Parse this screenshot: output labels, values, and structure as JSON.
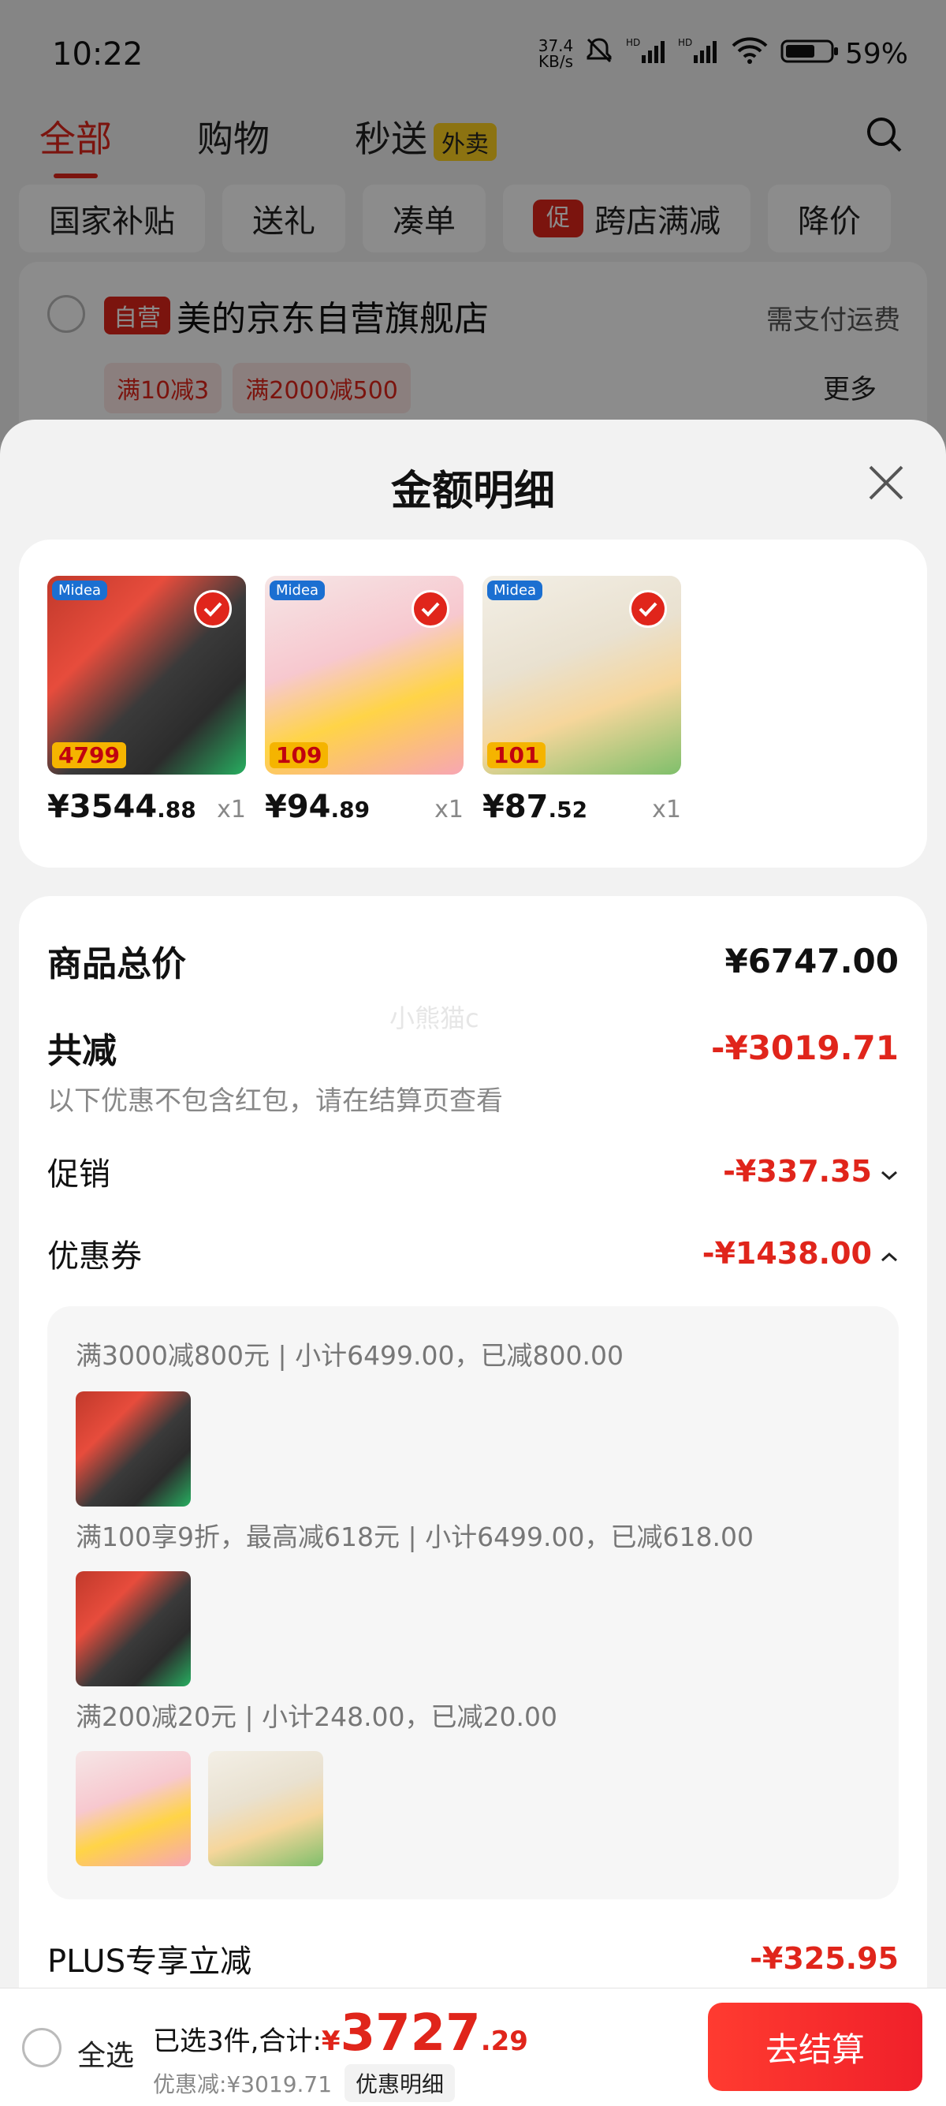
{
  "status_bar": {
    "time": "10:22",
    "net_speed_value": "37.4",
    "net_speed_unit": "KB/s",
    "battery": "59%",
    "icons": [
      "bell-muted-icon",
      "hd-signal-icon",
      "hd-signal-icon",
      "wifi-icon",
      "battery-icon"
    ]
  },
  "top_tabs": {
    "items": [
      "全部",
      "购物",
      "秒送"
    ],
    "waimai_badge": "外卖",
    "active_index": 0
  },
  "filters": {
    "items": [
      "国家补贴",
      "送礼",
      "凑单",
      "跨店满减",
      "降价"
    ],
    "promo_badge": "促"
  },
  "shop": {
    "badge": "自营",
    "name": "美的京东自营旗舰店",
    "shipping_note": "需支付运费",
    "coupons": [
      "满10减3",
      "满2000减500"
    ],
    "more": "更多"
  },
  "sheet": {
    "title": "金额明细",
    "products": [
      {
        "price_int": "¥3544",
        "price_dec": ".88",
        "qty": "x1",
        "thumb_badge": "Midea",
        "thumb_price": "4799"
      },
      {
        "price_int": "¥94",
        "price_dec": ".89",
        "qty": "x1",
        "thumb_badge": "Midea",
        "thumb_price": "109"
      },
      {
        "price_int": "¥87",
        "price_dec": ".52",
        "qty": "x1",
        "thumb_badge": "Midea",
        "thumb_price": "101"
      }
    ],
    "watermark": "小熊猫c",
    "rows": {
      "total_label": "商品总价",
      "total_value": "¥6747.00",
      "reduce_label": "共减",
      "reduce_value": "-¥3019.71",
      "reduce_note": "以下优惠不包含红包，请在结算页查看",
      "promo_label": "促销",
      "promo_value": "-¥337.35",
      "coupon_label": "优惠券",
      "coupon_value": "-¥1438.00",
      "plus_label": "PLUS专享立减",
      "plus_value": "-¥325.95"
    },
    "coupon_details": [
      "满3000减800元 | 小计6499.00，已减800.00",
      "满100享9折，最高减618元 | 小计6499.00，已减618.00",
      "满200减20元 | 小计248.00，已减20.00"
    ]
  },
  "bottom_bar": {
    "select_all": "全选",
    "total_prefix": "已选3件,合计:",
    "yen": "¥",
    "total_int": "3727",
    "total_dec": ".29",
    "discount_text": "优惠减:¥3019.71",
    "discount_detail": "优惠明细",
    "checkout": "去结算"
  },
  "colors": {
    "accent_red": "#e0251b",
    "promo_yellow": "#ffd21f"
  }
}
